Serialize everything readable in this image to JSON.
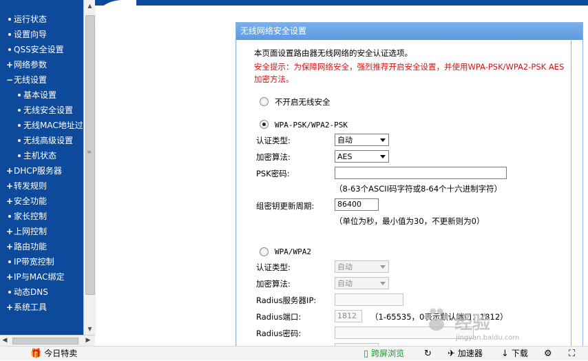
{
  "menu": {
    "items": [
      {
        "marker": "dot",
        "label": "运行状态",
        "level": 0
      },
      {
        "marker": "dot",
        "label": "设置向导",
        "level": 0
      },
      {
        "marker": "dot",
        "label": "QSS安全设置",
        "level": 0
      },
      {
        "marker": "+",
        "label": "网络参数",
        "level": 0
      },
      {
        "marker": "−",
        "label": "无线设置",
        "level": 0
      },
      {
        "marker": "dot",
        "label": "基本设置",
        "level": 1
      },
      {
        "marker": "dot",
        "label": "无线安全设置",
        "level": 1
      },
      {
        "marker": "dot",
        "label": "无线MAC地址过滤",
        "level": 1
      },
      {
        "marker": "dot",
        "label": "无线高级设置",
        "level": 1
      },
      {
        "marker": "dot",
        "label": "主机状态",
        "level": 1
      },
      {
        "marker": "+",
        "label": "DHCP服务器",
        "level": 0
      },
      {
        "marker": "+",
        "label": "转发规则",
        "level": 0
      },
      {
        "marker": "+",
        "label": "安全功能",
        "level": 0
      },
      {
        "marker": "dot",
        "label": "家长控制",
        "level": 0
      },
      {
        "marker": "+",
        "label": "上网控制",
        "level": 0
      },
      {
        "marker": "+",
        "label": "路由功能",
        "level": 0
      },
      {
        "marker": "dot",
        "label": "IP带宽控制",
        "level": 0
      },
      {
        "marker": "+",
        "label": "IP与MAC绑定",
        "level": 0
      },
      {
        "marker": "dot",
        "label": "动态DNS",
        "level": 0
      },
      {
        "marker": "+",
        "label": "系统工具",
        "level": 0
      }
    ]
  },
  "panel": {
    "title": "无线网络安全设置",
    "intro": "本页面设置路由器无线网络的安全认证选项。",
    "warning_line1": "安全提示：为保障网络安全，强烈推荐开启安全设置，并使用WPA-PSK/WPA2-PSK AES",
    "warning_line2": "加密方法。",
    "opt_none": "不开启无线安全",
    "wpa_psk": {
      "title": "WPA-PSK/WPA2-PSK",
      "auth_label": "认证类型:",
      "auth_value": "自动",
      "enc_label": "加密算法:",
      "enc_value": "AES",
      "psk_label": "PSK密码:",
      "psk_value": "",
      "psk_hint": "（8-63个ASCII码字符或8-64个十六进制字符）",
      "renew_label": "组密钥更新周期:",
      "renew_value": "86400",
      "renew_hint": "（单位为秒，最小值为30，不更新则为0）"
    },
    "wpa": {
      "title": "WPA/WPA2",
      "auth_label": "认证类型:",
      "auth_value": "自动",
      "enc_label": "加密算法:",
      "enc_value": "自动",
      "radius_ip_label": "Radius服务器IP:",
      "radius_ip_value": "",
      "radius_port_label": "Radius端口:",
      "radius_port_value": "1812",
      "radius_port_hint": "（1-65535，0表示默认端口：1812）",
      "radius_pwd_label": "Radius密码:"
    },
    "selected_option": "WPA-PSK/WPA2-PSK"
  },
  "watermark": {
    "brand": "经验",
    "url": "jingyan.baidu.com"
  },
  "statusbar": {
    "today": "今日特卖",
    "split": "跨屏浏览",
    "accelerator": "加速器",
    "download": "下载"
  },
  "colors": {
    "menu_bg": "#0d4a9c",
    "panel_header": "#6ba5e6",
    "warning": "#d11414",
    "split_green": "#1a9a2a"
  }
}
